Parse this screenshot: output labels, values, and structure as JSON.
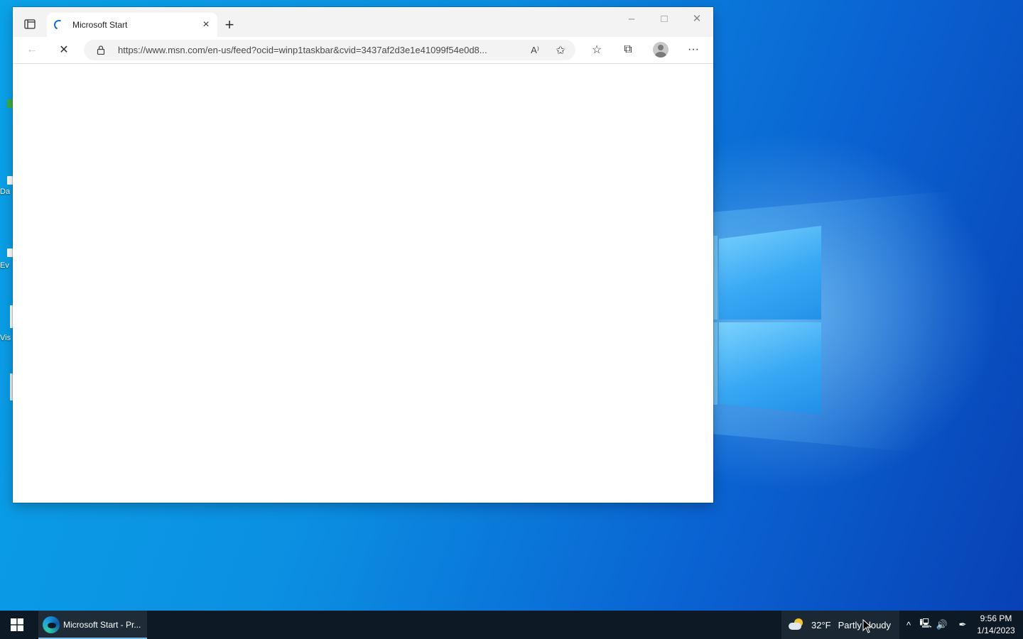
{
  "desktop": {
    "icons": [
      {
        "label": ""
      },
      {
        "label": "Da"
      },
      {
        "label": "Ev"
      },
      {
        "label": "Vis"
      }
    ]
  },
  "browser": {
    "tab": {
      "title": "Microsoft Start",
      "close_symbol": "×"
    },
    "new_tab_symbol": "+",
    "window_controls": {
      "minimize": "–",
      "maximize": "□",
      "close": "✕"
    },
    "toolbar": {
      "back_symbol": "←",
      "stop_symbol": "✕",
      "url": "https://www.msn.com/en-us/feed?ocid=winp1taskbar&cvid=3437af2d3e1e41099f54e0d8...",
      "read_aloud_symbol": "A⁾",
      "add_favorite_symbol": "✩",
      "favorites_symbol": "☆",
      "collections_symbol": "⧉",
      "more_symbol": "···"
    }
  },
  "taskbar": {
    "app_label": "Microsoft Start - Pr...",
    "weather": {
      "temp": "32°F",
      "condition": "Partly cloudy"
    },
    "tray": {
      "chevron": "^",
      "network": "🖳",
      "volume": "🔊",
      "pen": "✒"
    },
    "clock": {
      "time": "9:56 PM",
      "date": "1/14/2023"
    }
  },
  "colors": {
    "accent": "#0a6cd4",
    "taskbar": "#0d1a26",
    "desktop_light": "#0aa3e8",
    "desktop_dark": "#0841b5"
  }
}
